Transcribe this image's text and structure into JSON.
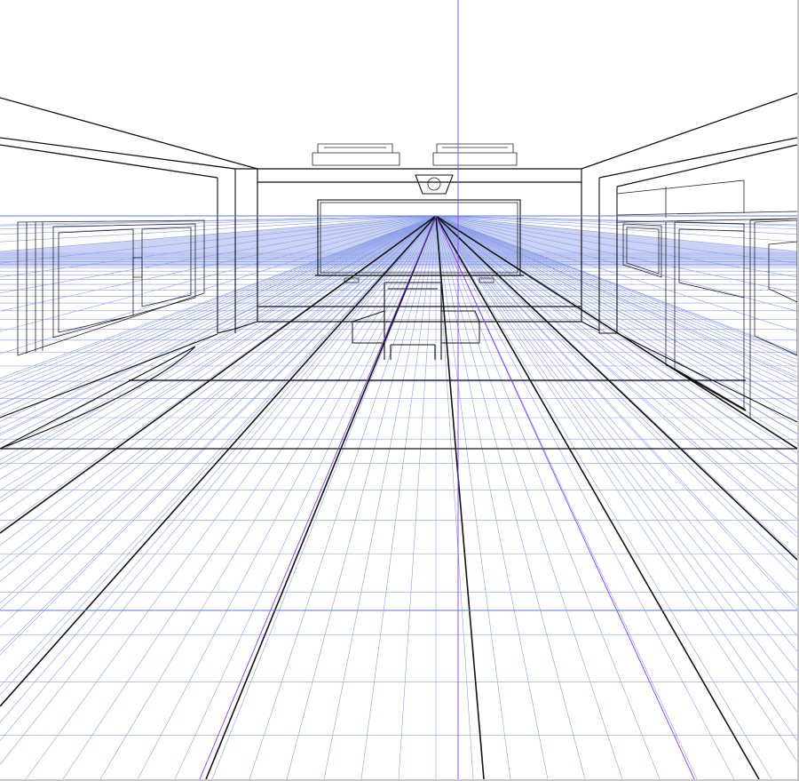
{
  "canvas": {
    "name": "perspective-room-sketch",
    "background": "#ffffff"
  },
  "colors": {
    "ink": "#111111",
    "perspective_grid": "#8d9fe8",
    "perspective_grid_strong": "#5b78d8",
    "guide_line": "#8a3cff",
    "horizon_fill": "#b8c4f2"
  },
  "perspective": {
    "type": "one-point"
  }
}
